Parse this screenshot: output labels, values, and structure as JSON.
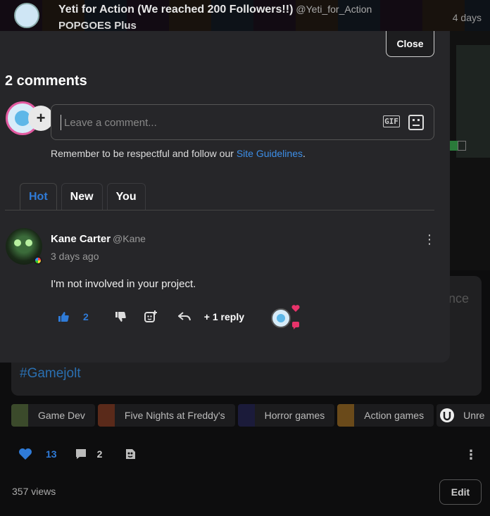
{
  "post": {
    "title": "Yeti for Action (We reached 200 Followers!!)",
    "handle": "@Yeti_for_Action",
    "subtitle": "POPGOES Plus",
    "time": "4 days",
    "card_fragment": "nce",
    "hashtag": "#Gamejolt",
    "tags": [
      "Game Dev",
      "Five Nights at Freddy's",
      "Horror games",
      "Action games",
      "Unre"
    ],
    "tag_colors": [
      "#3b4a2b",
      "#5a2a1a",
      "#1b1b3a",
      "#6a4a1a",
      "#eee"
    ],
    "like_count": "13",
    "comment_count": "2",
    "views": "357 views",
    "edit_label": "Edit"
  },
  "modal": {
    "close_label": "Close",
    "comments_title": "2 comments",
    "input_placeholder": "Leave a comment...",
    "gif_label": "GIF",
    "guidelines_prefix": "Remember to be respectful and follow our ",
    "guidelines_link": "Site Guidelines",
    "guidelines_suffix": ".",
    "tabs": [
      {
        "label": "Hot",
        "active": true
      },
      {
        "label": "New",
        "active": false
      },
      {
        "label": "You",
        "active": false
      }
    ]
  },
  "comment": {
    "author": "Kane Carter",
    "handle": "@Kane",
    "time": "3 days ago",
    "body": "I'm not involved in your project.",
    "likes": "2",
    "reply_label": "+ 1 reply"
  },
  "colors": {
    "accent": "#2f7bd8",
    "modal_bg": "#262629",
    "heart": "#e8336a"
  }
}
